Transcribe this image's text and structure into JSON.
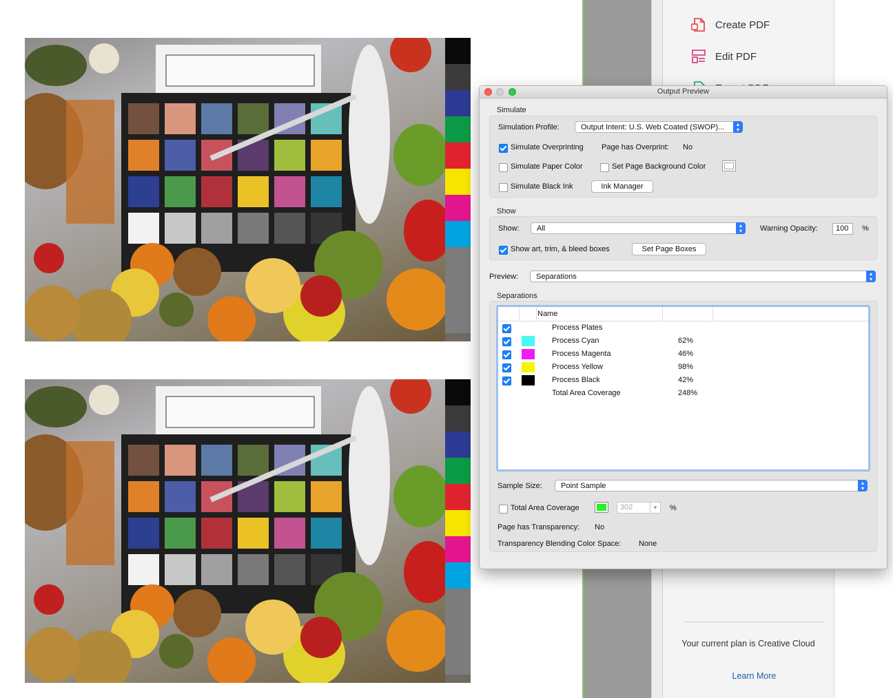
{
  "tools_panel": {
    "items": [
      {
        "label": "Create PDF",
        "icon": "create-pdf-icon"
      },
      {
        "label": "Edit PDF",
        "icon": "edit-pdf-icon"
      },
      {
        "label": "Export PDF",
        "icon": "export-pdf-icon"
      }
    ],
    "plan_text": "Your current plan is Creative Cloud",
    "learn_more": "Learn More"
  },
  "color_bars": [
    "#0a0a0a",
    "#3b3b3b",
    "#2e3a93",
    "#0b9a45",
    "#e0232e",
    "#f7e500",
    "#e3158f",
    "#00a4e0"
  ],
  "dialog": {
    "title": "Output Preview",
    "simulate": {
      "section": "Simulate",
      "profile_label": "Simulation Profile:",
      "profile_value": "Output Intent: U.S. Web Coated (SWOP)...",
      "simulate_overprinting": "Simulate Overprinting",
      "page_has_overprint_label": "Page has Overprint:",
      "page_has_overprint_value": "No",
      "simulate_paper_color": "Simulate Paper Color",
      "set_page_background_color": "Set Page Background Color",
      "simulate_black_ink": "Simulate Black Ink",
      "ink_manager": "Ink Manager"
    },
    "show": {
      "section": "Show",
      "show_label": "Show:",
      "show_value": "All",
      "warning_opacity_label": "Warning Opacity:",
      "warning_opacity_value": "100",
      "percent": "%",
      "show_boxes": "Show art, trim, & bleed boxes",
      "set_page_boxes": "Set Page Boxes"
    },
    "preview": {
      "label": "Preview:",
      "value": "Separations"
    },
    "separations": {
      "section": "Separations",
      "column_name": "Name",
      "rows": [
        {
          "name": "Process Plates",
          "percent": "",
          "color": "",
          "checked": true
        },
        {
          "name": "Process Cyan",
          "percent": "62%",
          "color": "#4df5f5",
          "checked": true
        },
        {
          "name": "Process Magenta",
          "percent": "46%",
          "color": "#f01cf0",
          "checked": true
        },
        {
          "name": "Process Yellow",
          "percent": "98%",
          "color": "#f5f50a",
          "checked": true
        },
        {
          "name": "Process Black",
          "percent": "42%",
          "color": "#000000",
          "checked": true
        },
        {
          "name": "Total Area Coverage",
          "percent": "248%",
          "color": "",
          "checked": false
        }
      ],
      "sample_size_label": "Sample Size:",
      "sample_size_value": "Point Sample",
      "total_area_coverage": "Total Area Coverage",
      "total_area_value": "302",
      "percent": "%",
      "page_has_transparency_label": "Page has Transparency:",
      "page_has_transparency_value": "No",
      "blending_label": "Transparency Blending Color Space:",
      "blending_value": "None"
    }
  }
}
